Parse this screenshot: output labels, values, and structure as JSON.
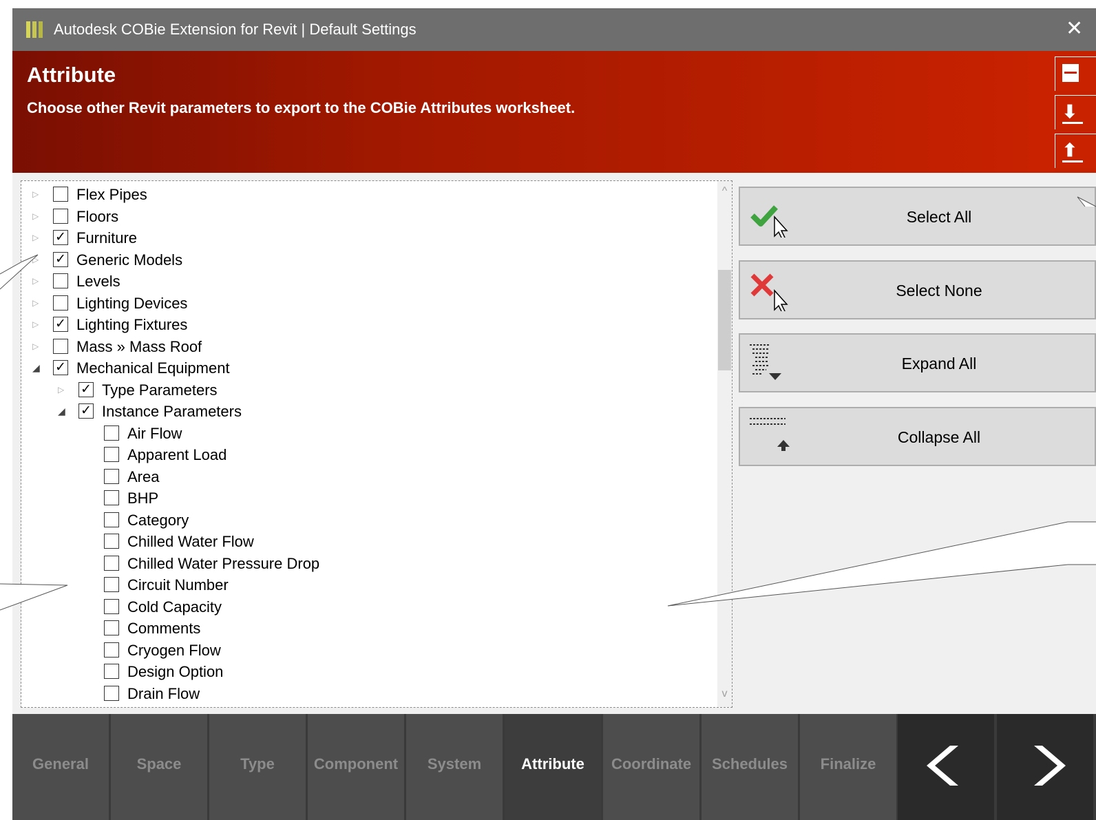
{
  "window": {
    "title": "Autodesk COBie Extension for Revit | Default Settings",
    "close_glyph": "✕"
  },
  "header": {
    "title": "Attribute",
    "subtitle": "Choose other Revit parameters to export to the COBie Attributes worksheet.",
    "color_start": "#7a0f02",
    "color_end": "#c92200",
    "side_buttons": [
      {
        "icon": "save-icon"
      },
      {
        "icon": "import-icon",
        "glyph": "⬇"
      },
      {
        "icon": "export-icon",
        "glyph": "⬆"
      }
    ]
  },
  "tree": {
    "items": [
      {
        "label": "Flex Pipes",
        "level": 0,
        "checked": false,
        "expanded": false
      },
      {
        "label": "Floors",
        "level": 0,
        "checked": false,
        "expanded": false
      },
      {
        "label": "Furniture",
        "level": 0,
        "checked": true,
        "expanded": false
      },
      {
        "label": "Generic Models",
        "level": 0,
        "checked": true,
        "expanded": false
      },
      {
        "label": "Levels",
        "level": 0,
        "checked": false,
        "expanded": false
      },
      {
        "label": "Lighting Devices",
        "level": 0,
        "checked": false,
        "expanded": false
      },
      {
        "label": "Lighting Fixtures",
        "level": 0,
        "checked": true,
        "expanded": false
      },
      {
        "label": "Mass » Mass Roof",
        "level": 0,
        "checked": false,
        "expanded": false
      },
      {
        "label": "Mechanical Equipment",
        "level": 0,
        "checked": true,
        "expanded": true
      },
      {
        "label": "Type Parameters",
        "level": 1,
        "checked": true,
        "expanded": false
      },
      {
        "label": "Instance Parameters",
        "level": 1,
        "checked": true,
        "expanded": true
      },
      {
        "label": "Air Flow",
        "level": 2,
        "checked": false
      },
      {
        "label": "Apparent Load",
        "level": 2,
        "checked": false
      },
      {
        "label": "Area",
        "level": 2,
        "checked": false
      },
      {
        "label": "BHP",
        "level": 2,
        "checked": false
      },
      {
        "label": "Category",
        "level": 2,
        "checked": false
      },
      {
        "label": "Chilled Water Flow",
        "level": 2,
        "checked": false
      },
      {
        "label": "Chilled Water Pressure Drop",
        "level": 2,
        "checked": false
      },
      {
        "label": "Circuit Number",
        "level": 2,
        "checked": false
      },
      {
        "label": "Cold Capacity",
        "level": 2,
        "checked": false
      },
      {
        "label": "Comments",
        "level": 2,
        "checked": false
      },
      {
        "label": "Cryogen Flow",
        "level": 2,
        "checked": false
      },
      {
        "label": "Design Option",
        "level": 2,
        "checked": false
      },
      {
        "label": "Drain Flow",
        "level": 2,
        "checked": false
      }
    ],
    "scroll_glyph_up": "^",
    "scroll_glyph_down": "v"
  },
  "actions": {
    "select_all": "Select All",
    "select_none": "Select None",
    "expand_all": "Expand All",
    "collapse_all": "Collapse All"
  },
  "nav": {
    "tabs": [
      "General",
      "Space",
      "Type",
      "Component",
      "System",
      "Attribute",
      "Coordinate",
      "Schedules",
      "Finalize"
    ],
    "active": "Attribute"
  },
  "colors": {
    "check_green": "#3fa33f",
    "cross_red": "#e0393a",
    "nav_bg": "#4d4d4d"
  }
}
